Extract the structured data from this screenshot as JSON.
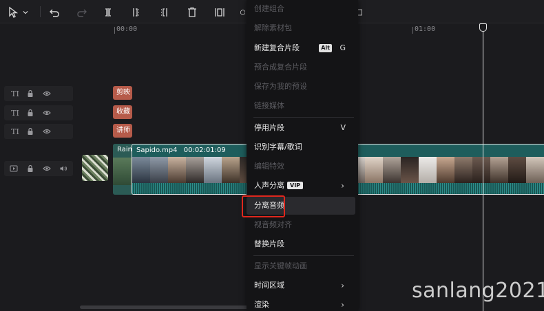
{
  "toolbar": {
    "tools": [
      "select-arrow",
      "dropdown-caret",
      "undo",
      "redo",
      "split",
      "split-left",
      "split-right",
      "delete",
      "freeze-frame",
      "crop"
    ]
  },
  "ruler": {
    "labels": [
      "00:00",
      "01:00"
    ]
  },
  "tracks": {
    "text_clips": [
      "剪映",
      "收藏",
      "讲师"
    ],
    "text_track_icon": "TI",
    "rain_clip_label": "Rain",
    "main_clip_name": "Sapido.mp4",
    "main_clip_duration": "00:02:01:09"
  },
  "menu": {
    "items": [
      {
        "label": "创建组合",
        "enabled": false
      },
      {
        "label": "解除素材包",
        "enabled": false
      },
      {
        "label": "新建复合片段",
        "enabled": true,
        "shortcut_modifier": "Alt",
        "shortcut_key": "G"
      },
      {
        "label": "预合成复合片段",
        "enabled": false
      },
      {
        "label": "保存为我的预设",
        "enabled": false
      },
      {
        "label": "链接媒体",
        "enabled": false
      },
      {
        "label": "停用片段",
        "enabled": true,
        "shortcut_key": "V"
      },
      {
        "label": "识别字幕/歌词",
        "enabled": true
      },
      {
        "label": "编辑特效",
        "enabled": false
      },
      {
        "label": "人声分离",
        "enabled": true,
        "badge": "VIP",
        "submenu": true
      },
      {
        "label": "分离音频",
        "enabled": true,
        "highlighted": true
      },
      {
        "label": "视音频对齐",
        "enabled": false
      },
      {
        "label": "替换片段",
        "enabled": true
      },
      {
        "label": "显示关键帧动画",
        "enabled": false
      },
      {
        "label": "时间区域",
        "enabled": true,
        "submenu": true
      },
      {
        "label": "渲染",
        "enabled": true,
        "submenu": true
      }
    ]
  },
  "watermark": "sanlang2021",
  "colors": {
    "text_clip": "#b65b4a",
    "video_track": "#1e5d5c",
    "highlight_box": "#e0271d"
  }
}
